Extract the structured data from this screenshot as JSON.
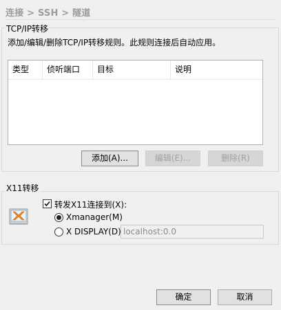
{
  "breadcrumb": "连接 > SSH > 隧道",
  "tcp_group": {
    "title": "TCP/IP转移",
    "description": "添加/编辑/删除TCP/IP转移规则。此规则连接后自动应用。",
    "columns": [
      "类型",
      "侦听端口",
      "目标",
      "说明"
    ],
    "rows": [],
    "buttons": {
      "add": "添加(A)...",
      "edit": "编辑(E)...",
      "delete": "删除(R)"
    }
  },
  "x11_group": {
    "title": "X11转移",
    "icon": "xmanager-icon",
    "forward_label": "转发X11连接到(X):",
    "forward_checked": true,
    "options": [
      {
        "label": "Xmanager(M)",
        "selected": true
      },
      {
        "label": "X DISPLAY(D):",
        "selected": false
      }
    ],
    "display_value": "localhost:0.0"
  },
  "footer": {
    "ok": "确定",
    "cancel": "取消"
  }
}
